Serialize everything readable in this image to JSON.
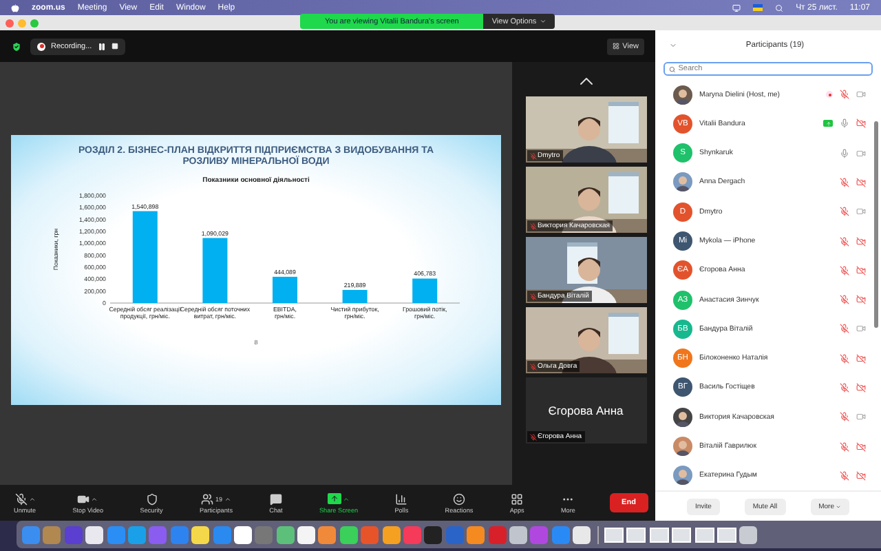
{
  "menu_bar": {
    "app": "zoom.us",
    "menus": [
      "Meeting",
      "View",
      "Edit",
      "Window",
      "Help"
    ],
    "date": "Чт 25 лист.",
    "time": "11:07"
  },
  "share_banner": {
    "text": "You are viewing Vitalii Bandura's screen",
    "options": "View Options"
  },
  "meeting_bar": {
    "recording": "Recording...",
    "view": "View"
  },
  "slide": {
    "title": "РОЗДІЛ 2. БІЗНЕС-ПЛАН ВІДКРИТТЯ ПІДПРИЄМСТВА З ВИДОБУВАННЯ ТА РОЗЛИВУ МІНЕРАЛЬНОЇ ВОДИ",
    "page": "8",
    "chart_data": {
      "type": "bar",
      "title": "Показники основної діяльності",
      "ylabel": "Показники, грн",
      "categories": [
        "Середній обсяг реалізації продукції, грн/міс.",
        "Середній обсяг поточних витрат, грн/міс.",
        "EBITDA, грн/міс.",
        "Чистий прибуток, грн/міс.",
        "Грошовий потік, грн/міс."
      ],
      "series": [
        {
          "color": "#00b0f0",
          "values": [
            1540000,
            1090000,
            440000,
            220000,
            410000
          ]
        }
      ],
      "value_labels": [
        "1,540,898",
        "1,090,029",
        "444,089",
        "219,889",
        "406,783"
      ],
      "ylim": [
        0,
        1800000
      ],
      "yticks": [
        {
          "value": 0,
          "label": "0"
        },
        {
          "value": 200000,
          "label": "200,000"
        },
        {
          "value": 400000,
          "label": "400,000"
        },
        {
          "value": 600000,
          "label": "600,000"
        },
        {
          "value": 800000,
          "label": "800,000"
        },
        {
          "value": 1000000,
          "label": "1,000,000"
        },
        {
          "value": 1200000,
          "label": "1,200,000"
        },
        {
          "value": 1400000,
          "label": "1,400,000"
        },
        {
          "value": 1600000,
          "label": "1,600,000"
        },
        {
          "value": 1800000,
          "label": "1,800,000"
        }
      ]
    }
  },
  "video_strip": [
    {
      "name": "Dmytro",
      "kind": "picture",
      "muted": true
    },
    {
      "name": "Виктория Качаровская",
      "kind": "picture",
      "muted": true
    },
    {
      "name": "Бандура Віталій",
      "kind": "picture",
      "muted": true
    },
    {
      "name": "Ольга Довга",
      "kind": "picture",
      "muted": true
    },
    {
      "name": "Єгорова Анна",
      "kind": "name_only",
      "display_name": "Єгорова Анна",
      "muted": true
    }
  ],
  "participants": {
    "title": "Participants (19)",
    "search": {
      "placeholder": "Search"
    },
    "items": [
      {
        "name": "Maryna Dielini (Host, me)",
        "recording": true,
        "sharing": false,
        "muted": true,
        "video_off": false
      },
      {
        "name": "Vitalii Bandura",
        "avatar": {
          "kind": "initials",
          "initials": "VB",
          "color": "#e2532d"
        },
        "recording": false,
        "sharing": true,
        "muted": false,
        "video_off": true
      },
      {
        "name": "Shynkaruk",
        "avatar": {
          "kind": "initials",
          "initials": "S",
          "color": "#1fc16b"
        },
        "recording": false,
        "sharing": false,
        "muted": false,
        "video_off": false
      },
      {
        "name": "Anna Dergach",
        "recording": false,
        "sharing": false,
        "muted": true,
        "video_off": true
      },
      {
        "name": "Dmytro",
        "avatar": {
          "kind": "initials",
          "initials": "D",
          "color": "#e2532d"
        },
        "recording": false,
        "sharing": false,
        "muted": true,
        "video_off": false
      },
      {
        "name": "Mykola — iPhone",
        "avatar": {
          "kind": "initials",
          "initials": "Mi",
          "color": "#3e5670"
        },
        "recording": false,
        "sharing": false,
        "muted": true,
        "video_off": true
      },
      {
        "name": "Єгорова Анна",
        "avatar": {
          "kind": "initials",
          "initials": "ЄА",
          "color": "#e2532d"
        },
        "recording": false,
        "sharing": false,
        "muted": true,
        "video_off": true
      },
      {
        "name": "Анастасия Зинчук",
        "avatar": {
          "kind": "initials",
          "initials": "АЗ",
          "color": "#1fc16b"
        },
        "recording": false,
        "sharing": false,
        "muted": true,
        "video_off": true
      },
      {
        "name": "Бандура Віталій",
        "avatar": {
          "kind": "initials",
          "initials": "БВ",
          "color": "#17b88e"
        },
        "recording": false,
        "sharing": false,
        "muted": true,
        "video_off": false
      },
      {
        "name": "Білоконенко Наталія",
        "avatar": {
          "kind": "initials",
          "initials": "БН",
          "color": "#f0761c"
        },
        "recording": false,
        "sharing": false,
        "muted": true,
        "video_off": true
      },
      {
        "name": "Василь Гостіщев",
        "avatar": {
          "kind": "initials",
          "initials": "ВГ",
          "color": "#3e5670"
        },
        "recording": false,
        "sharing": false,
        "muted": true,
        "video_off": true
      },
      {
        "name": "Виктория Качаровская",
        "recording": false,
        "sharing": false,
        "muted": true,
        "video_off": false
      },
      {
        "name": "Віталій Гаврилюк",
        "recording": false,
        "sharing": false,
        "muted": true,
        "video_off": true
      },
      {
        "name": "Екатерина Гудым",
        "recording": false,
        "sharing": false,
        "muted": true,
        "video_off": true
      }
    ],
    "buttons": [
      "Invite",
      "Mute All",
      "More"
    ]
  },
  "toolbar": [
    {
      "label": "Unmute",
      "caret": true,
      "active": false
    },
    {
      "label": "Stop Video",
      "caret": true,
      "active": false
    },
    {
      "label": "Security",
      "caret": false,
      "active": false
    },
    {
      "label": "Participants",
      "badge": "19",
      "caret": true,
      "active": false
    },
    {
      "label": "Chat",
      "caret": false,
      "active": false
    },
    {
      "label": "Share Screen",
      "caret": true,
      "active": true
    },
    {
      "label": "Polls",
      "caret": false,
      "active": false
    },
    {
      "label": "Reactions",
      "caret": false,
      "active": false
    },
    {
      "label": "Apps",
      "caret": false,
      "active": false
    },
    {
      "label": "More",
      "caret": false,
      "active": false
    }
  ],
  "end_button": "End"
}
